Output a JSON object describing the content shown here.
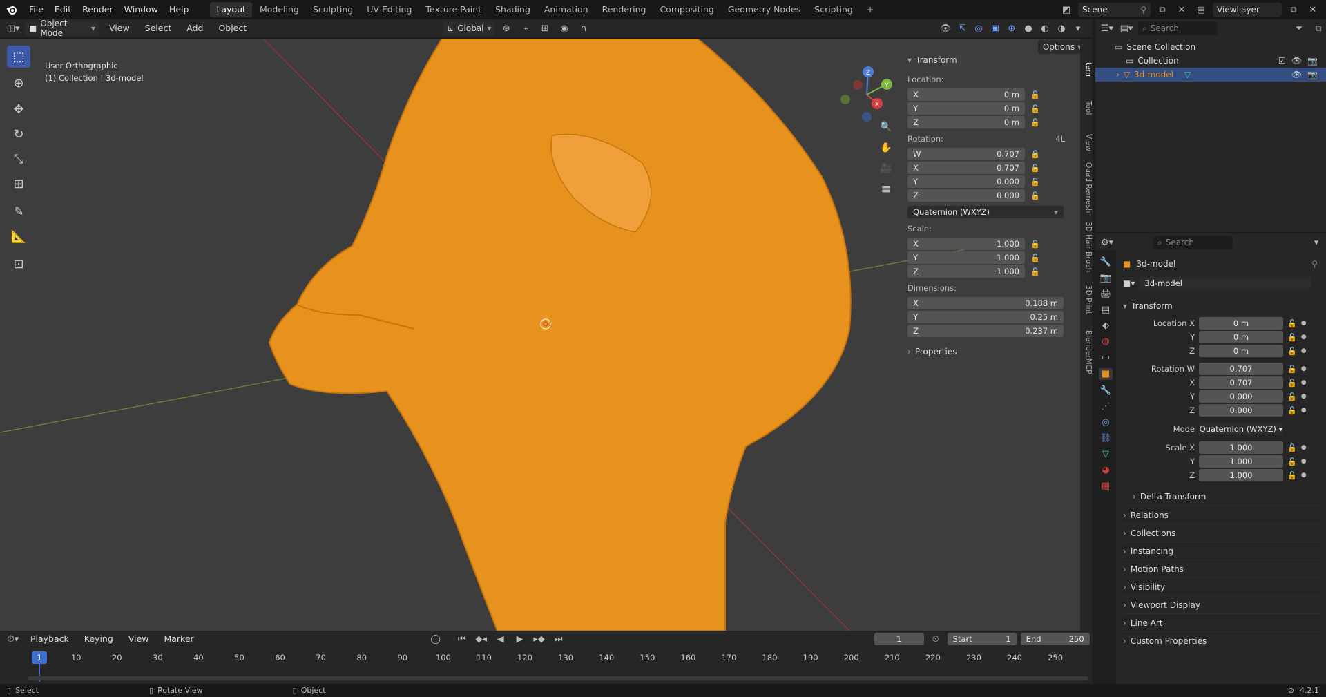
{
  "menus": [
    "File",
    "Edit",
    "Render",
    "Window",
    "Help"
  ],
  "workspaces": [
    "Layout",
    "Modeling",
    "Sculpting",
    "UV Editing",
    "Texture Paint",
    "Shading",
    "Animation",
    "Rendering",
    "Compositing",
    "Geometry Nodes",
    "Scripting"
  ],
  "active_workspace": "Layout",
  "scene": "Scene",
  "view_layer": "ViewLayer",
  "viewport_header": {
    "mode": "Object Mode",
    "menu": [
      "View",
      "Select",
      "Add",
      "Object"
    ],
    "orientation": "Global",
    "options": "Options"
  },
  "viewport": {
    "view_name": "User Orthographic",
    "collection_info": "(1) Collection | 3d-model",
    "model_color": "#e8921e",
    "background": "#3d3d3d"
  },
  "npanel": {
    "title": "Transform",
    "location_label": "Location:",
    "location": [
      {
        "axis": "X",
        "value": "0 m"
      },
      {
        "axis": "Y",
        "value": "0 m"
      },
      {
        "axis": "Z",
        "value": "0 m"
      }
    ],
    "rotation_label": "Rotation:",
    "rotation_mode_short": "4L",
    "rotation": [
      {
        "axis": "W",
        "value": "0.707"
      },
      {
        "axis": "X",
        "value": "0.707"
      },
      {
        "axis": "Y",
        "value": "0.000"
      },
      {
        "axis": "Z",
        "value": "0.000"
      }
    ],
    "rotation_mode": "Quaternion (WXYZ)",
    "scale_label": "Scale:",
    "scale": [
      {
        "axis": "X",
        "value": "1.000"
      },
      {
        "axis": "Y",
        "value": "1.000"
      },
      {
        "axis": "Z",
        "value": "1.000"
      }
    ],
    "dimensions_label": "Dimensions:",
    "dimensions": [
      {
        "axis": "X",
        "value": "0.188 m"
      },
      {
        "axis": "Y",
        "value": "0.25 m"
      },
      {
        "axis": "Z",
        "value": "0.237 m"
      }
    ],
    "properties": "Properties"
  },
  "side_tabs": [
    "Item",
    "Tool",
    "View",
    "Quad Remesh",
    "3D Hair Brush",
    "3D Print",
    "BlenderMCP"
  ],
  "outliner": {
    "search_placeholder": "Search",
    "items": [
      {
        "label": "Scene Collection",
        "level": 0
      },
      {
        "label": "Collection",
        "level": 1
      },
      {
        "label": "3d-model",
        "level": 2,
        "selected": true
      }
    ]
  },
  "properties": {
    "search_placeholder": "Search",
    "object_name": "3d-model",
    "object_field": "3d-model",
    "transform_title": "Transform",
    "location_rows": [
      {
        "label": "Location X",
        "value": "0 m"
      },
      {
        "label": "Y",
        "value": "0 m"
      },
      {
        "label": "Z",
        "value": "0 m"
      }
    ],
    "rotation_rows": [
      {
        "label": "Rotation W",
        "value": "0.707"
      },
      {
        "label": "X",
        "value": "0.707"
      },
      {
        "label": "Y",
        "value": "0.000"
      },
      {
        "label": "Z",
        "value": "0.000"
      }
    ],
    "mode_label": "Mode",
    "mode_value": "Quaternion (WXYZ)",
    "scale_rows": [
      {
        "label": "Scale X",
        "value": "1.000"
      },
      {
        "label": "Y",
        "value": "1.000"
      },
      {
        "label": "Z",
        "value": "1.000"
      }
    ],
    "delta_transform": "Delta Transform",
    "sections": [
      "Relations",
      "Collections",
      "Instancing",
      "Motion Paths",
      "Visibility",
      "Viewport Display",
      "Line Art",
      "Custom Properties"
    ]
  },
  "timeline": {
    "menus": [
      "Playback",
      "Keying",
      "View",
      "Marker"
    ],
    "current_frame": "1",
    "start_label": "Start",
    "start": "1",
    "end_label": "End",
    "end": "250",
    "ticks": [
      "1",
      "10",
      "20",
      "30",
      "40",
      "50",
      "60",
      "70",
      "80",
      "90",
      "100",
      "110",
      "120",
      "130",
      "140",
      "150",
      "160",
      "170",
      "180",
      "190",
      "200",
      "210",
      "220",
      "230",
      "240",
      "250"
    ]
  },
  "statusbar": {
    "select": "Select",
    "rotate": "Rotate View",
    "object": "Object",
    "version": "4.2.1"
  },
  "accent_color": "#3c5aa8",
  "selected_color": "#e8921e"
}
